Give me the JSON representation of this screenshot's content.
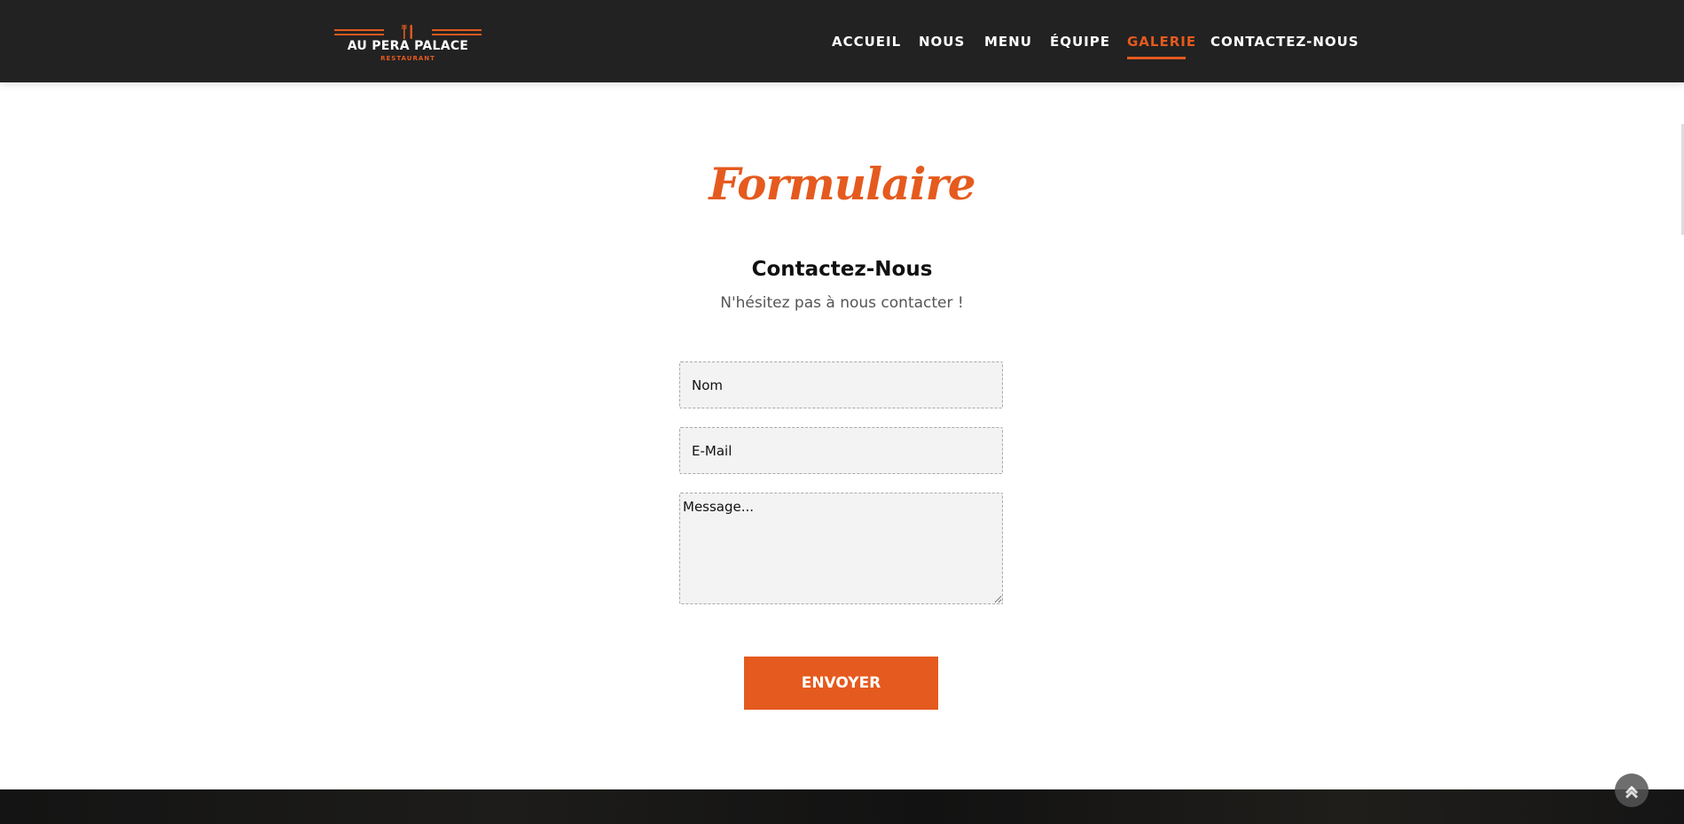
{
  "brand": {
    "name": "AU PERA PALACE",
    "tagline": "RESTAURANT",
    "accent_color": "#e55a1e",
    "logo_icon": "fork-knife-icon"
  },
  "nav": {
    "items": [
      {
        "label": "ACCUEIL",
        "active": false
      },
      {
        "label": "NOUS",
        "active": false
      },
      {
        "label": "MENU",
        "active": false
      },
      {
        "label": "ÉQUIPE",
        "active": false
      },
      {
        "label": "GALERIE",
        "active": true
      },
      {
        "label": "CONTACTEZ-NOUS",
        "active": false
      }
    ]
  },
  "contact": {
    "section_title": "Formulaire",
    "heading": "Contactez-Nous",
    "subheading": "N'hésitez pas à nous contacter !",
    "name_placeholder": "Nom",
    "email_placeholder": "E-Mail",
    "message_placeholder": "Message...",
    "submit_label": "ENVOYER"
  },
  "scroll_top": {
    "icon": "chevron-up-icon"
  }
}
